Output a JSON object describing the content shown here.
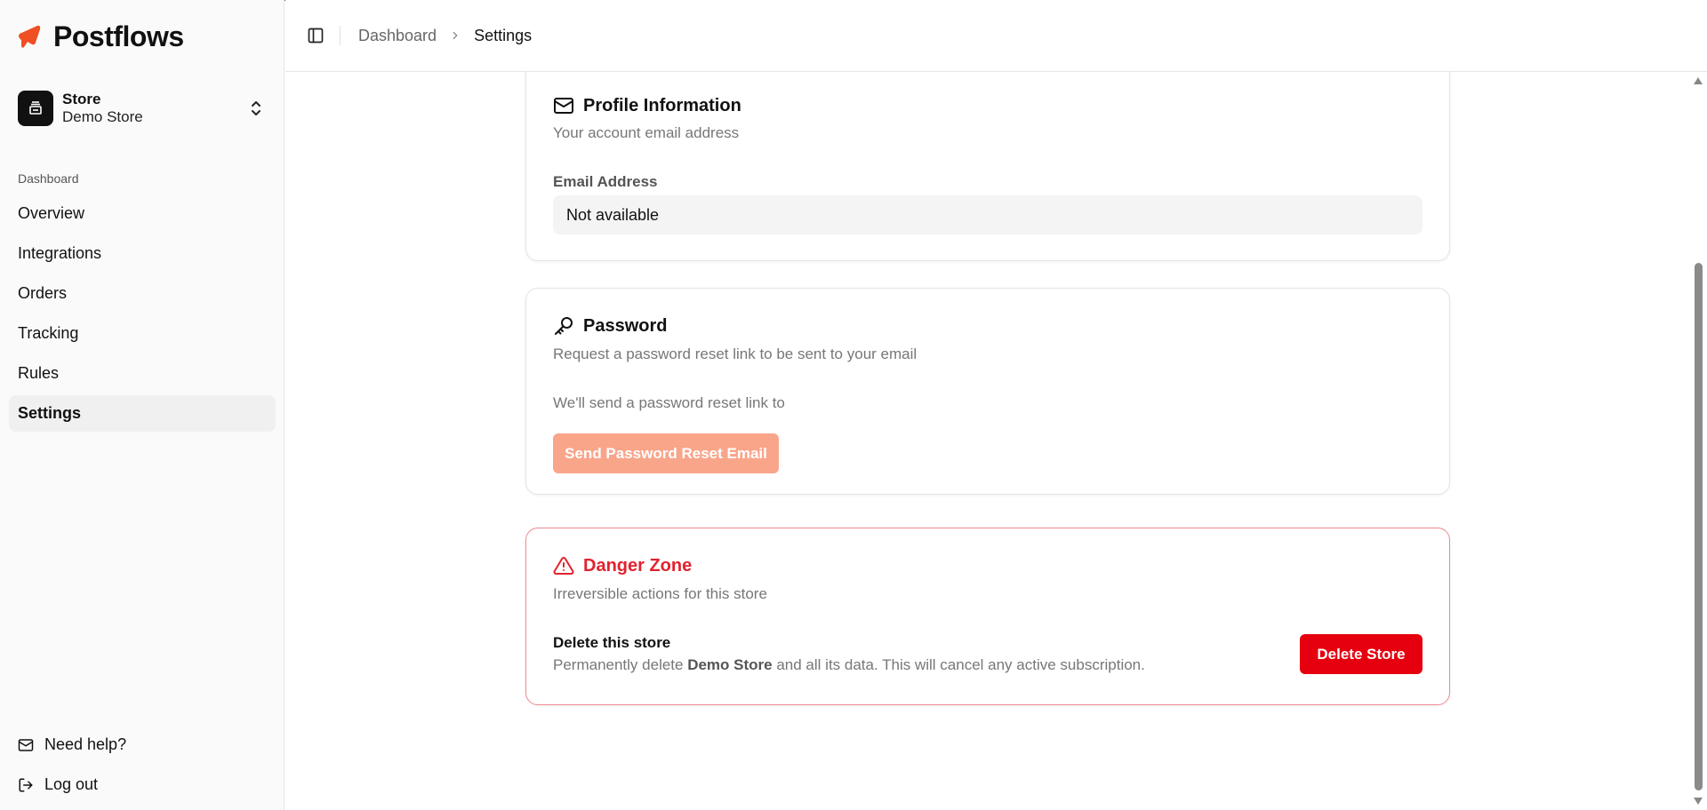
{
  "brand": {
    "name": "Postflows",
    "accent": "#f04e23"
  },
  "store": {
    "title": "Store",
    "name": "Demo Store"
  },
  "sidebar": {
    "group_label": "Dashboard",
    "items": [
      {
        "label": "Overview"
      },
      {
        "label": "Integrations"
      },
      {
        "label": "Orders"
      },
      {
        "label": "Tracking"
      },
      {
        "label": "Rules"
      },
      {
        "label": "Settings",
        "active": true
      }
    ],
    "help_label": "Need help?",
    "logout_label": "Log out"
  },
  "breadcrumb": {
    "parent": "Dashboard",
    "current": "Settings"
  },
  "profile": {
    "title": "Profile Information",
    "description": "Your account email address",
    "email_label": "Email Address",
    "email_value": "Not available"
  },
  "password": {
    "title": "Password",
    "description": "Request a password reset link to be sent to your email",
    "note": "We'll send a password reset link to",
    "button_label": "Send Password Reset Email"
  },
  "danger": {
    "title": "Danger Zone",
    "description": "Irreversible actions for this store",
    "delete_label": "Delete this store",
    "delete_desc_prefix": "Permanently delete ",
    "delete_desc_store": "Demo Store",
    "delete_desc_suffix": " and all its data. This will cancel any active subscription.",
    "button_label": "Delete Store",
    "color": "#e6000f"
  }
}
